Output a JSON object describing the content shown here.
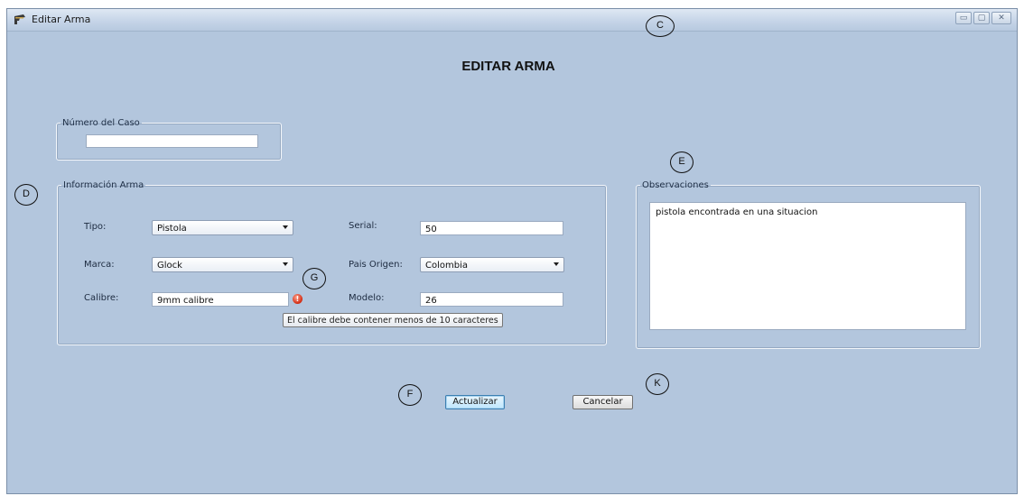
{
  "window": {
    "title": "Editar Arma",
    "controls": {
      "minimize": "▭",
      "maximize": "▢",
      "close": "✕"
    }
  },
  "heading": "EDITAR ARMA",
  "caso": {
    "legend": "Número del Caso",
    "value": ""
  },
  "arma": {
    "legend": "Información Arma",
    "tipo_label": "Tipo:",
    "tipo_value": "Pistola",
    "marca_label": "Marca:",
    "marca_value": "Glock",
    "calibre_label": "Calibre:",
    "calibre_value": "9mm calibre",
    "calibre_error_icon": "!",
    "calibre_tooltip": "El calibre debe contener menos de 10 caracteres",
    "serial_label": "Serial:",
    "serial_value": "50",
    "pais_label": "Pais Origen:",
    "pais_value": "Colombia",
    "modelo_label": "Modelo:",
    "modelo_value": "26"
  },
  "observaciones": {
    "legend": "Observaciones",
    "value": "pistola encontrada en una situacion"
  },
  "buttons": {
    "actualizar": "Actualizar",
    "cancelar": "Cancelar"
  },
  "markers": {
    "c": "C",
    "d": "D",
    "e": "E",
    "f": "F",
    "g": "G",
    "k": "K"
  },
  "colors": {
    "window_bg": "#b3c6dd",
    "error": "#d12b12"
  }
}
